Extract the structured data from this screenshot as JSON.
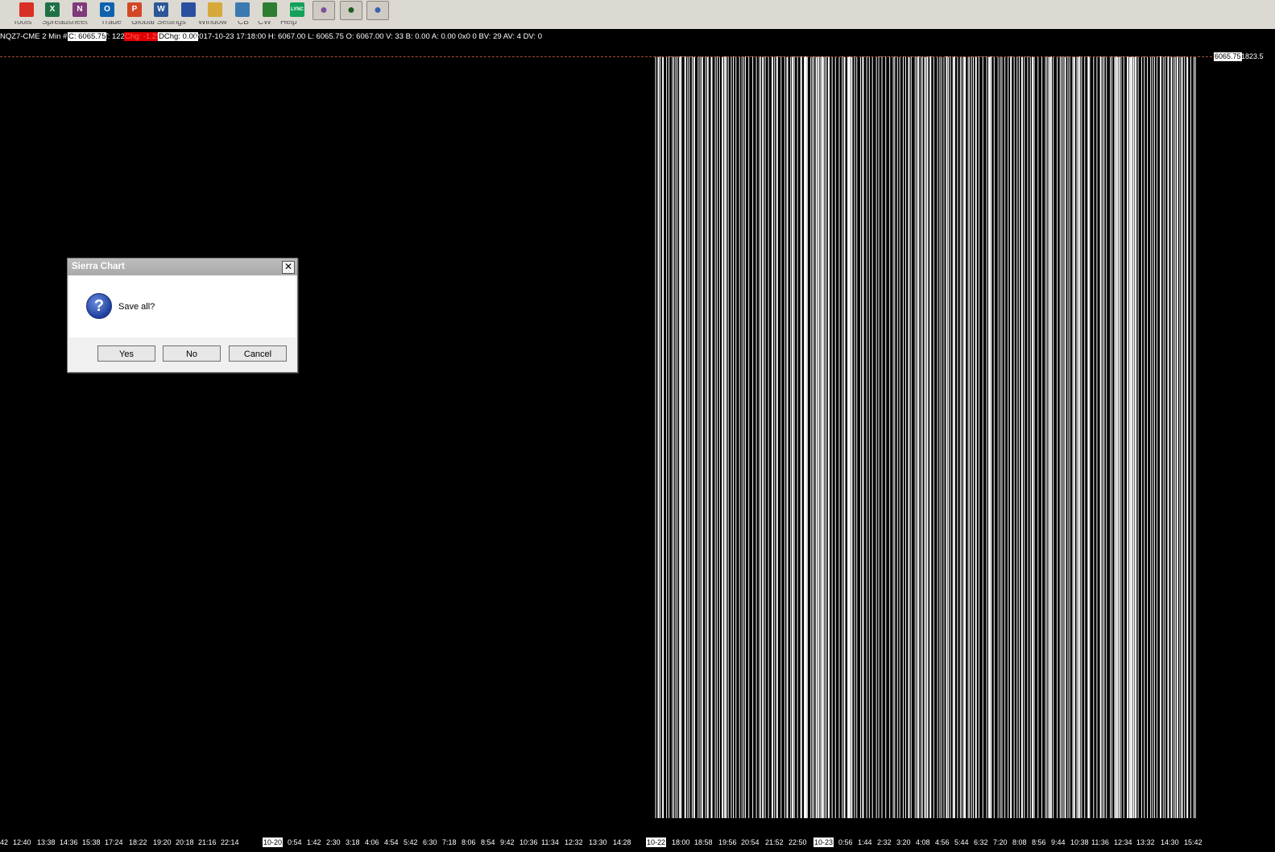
{
  "toolbar": {
    "icons": [
      {
        "name": "chrome-icon",
        "glyph": "",
        "color": "#d93025"
      },
      {
        "name": "excel-icon",
        "glyph": "X",
        "color": "#1e7145"
      },
      {
        "name": "onenote-icon",
        "glyph": "N",
        "color": "#80397b"
      },
      {
        "name": "outlook-icon",
        "glyph": "O",
        "color": "#0f62ae"
      },
      {
        "name": "powerpoint-icon",
        "glyph": "P",
        "color": "#d24726"
      },
      {
        "name": "word-icon",
        "glyph": "W",
        "color": "#2b5797"
      },
      {
        "name": "save-disk-icon",
        "glyph": "",
        "color": "#2b4fa0"
      },
      {
        "name": "folder-chart-icon",
        "glyph": "",
        "color": "#d7a83a"
      },
      {
        "name": "network-icon",
        "glyph": "",
        "color": "#3a7ab0"
      },
      {
        "name": "globe-icon",
        "glyph": "",
        "color": "#2e7d32"
      },
      {
        "name": "lync-icon",
        "glyph": "LYNC",
        "color": "#13a05a"
      },
      {
        "name": "viber-icon",
        "glyph": "",
        "color": "#7b519d"
      },
      {
        "name": "globe-icon-2",
        "glyph": "",
        "color": "#1b5e20"
      },
      {
        "name": "remote-desktop-icon",
        "glyph": "",
        "color": "#3a62b0"
      }
    ]
  },
  "menu": {
    "items": [
      "Tools",
      "Spreadsheet",
      "Trade",
      "Global Settings",
      "Window",
      "CB",
      "CW",
      "Help"
    ]
  },
  "infobar": {
    "symbol": "NQZ7-CME  2 Min  #1",
    "close": "C: 6065.75",
    "ticks": "T: 122",
    "chg": "Chg: -1.25",
    "dchg": "DChg: 0.00",
    "rest": "2017-10-23 17:18:00 H: 6067.00 L: 6065.75 O: 6067.00 V: 33 B: 0.00 A: 0.00 0x0 0 BV: 29 AV: 4 DV: 0"
  },
  "price": {
    "last": "6065.75",
    "right": "1823.5"
  },
  "time_axis": {
    "labels": [
      "42",
      "12:40",
      "13:38",
      "14:36",
      "15:38",
      "17:24",
      "18:22",
      "19:20",
      "20:18",
      "21:16",
      "22:14",
      "10-20",
      "0:54",
      "1:42",
      "2:30",
      "3:18",
      "4:06",
      "4:54",
      "5:42",
      "6:30",
      "7:18",
      "8:06",
      "8:54",
      "9:42",
      "10:36",
      "11:34",
      "12:32",
      "13:30",
      "14:28",
      "10-22",
      "18:00",
      "18:58",
      "19:56",
      "20:54",
      "21:52",
      "22:50",
      "10-23",
      "0:56",
      "1:44",
      "2:32",
      "3:20",
      "4:08",
      "4:56",
      "5:44",
      "6:32",
      "7:20",
      "8:08",
      "8:56",
      "9:44",
      "10:38",
      "11:36",
      "12:34",
      "13:32",
      "14:30",
      "15:42"
    ],
    "date_labels": [
      "10-20",
      "10-22",
      "10-23"
    ]
  },
  "dialog": {
    "title": "Sierra Chart",
    "message": "Save all?",
    "yes": "Yes",
    "no": "No",
    "cancel": "Cancel",
    "close_glyph": "✕",
    "icon_glyph": "?"
  }
}
